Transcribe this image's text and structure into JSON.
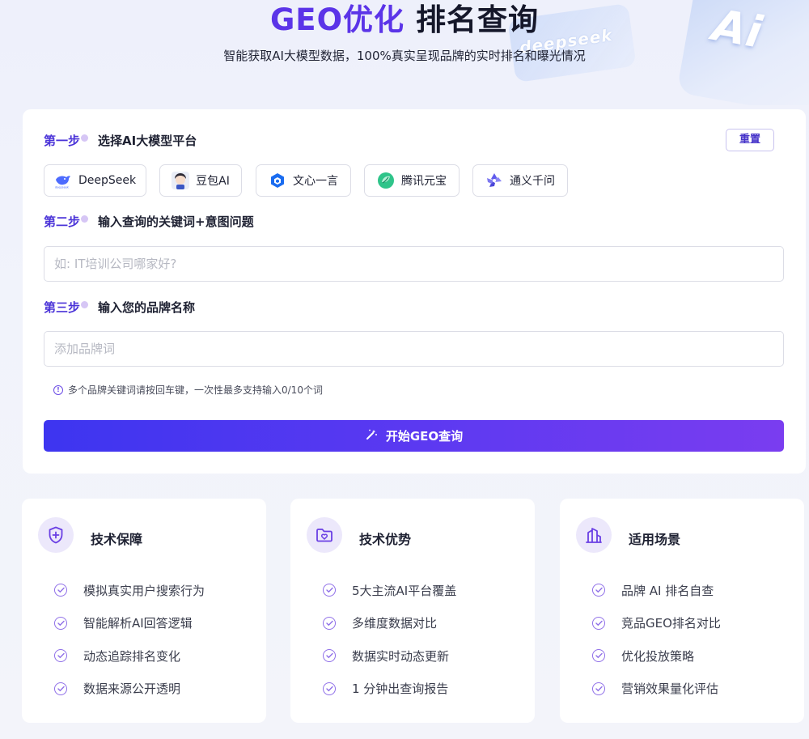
{
  "hero": {
    "title_accent": "GEO优化",
    "title_main": "排名查询",
    "subtitle": "智能获取AI大模型数据，100%真实呈现品牌的实时排名和曝光情况",
    "deco_badge": "deepseek",
    "deco_ai": "Ai"
  },
  "form": {
    "step1": {
      "num": "第一步",
      "label": "选择AI大模型平台"
    },
    "reset_label": "重置",
    "platforms": [
      {
        "label": "DeepSeek",
        "icon": "deepseek-whale-icon"
      },
      {
        "label": "豆包AI",
        "icon": "doubao-avatar-icon"
      },
      {
        "label": "文心一言",
        "icon": "wenxin-cube-icon"
      },
      {
        "label": "腾讯元宝",
        "icon": "yuanbao-leaf-icon"
      },
      {
        "label": "通义千问",
        "icon": "tongyi-star-icon"
      }
    ],
    "step2": {
      "num": "第二步",
      "label": "输入查询的关键词+意图问题"
    },
    "keyword_placeholder": "如: IT培训公司哪家好?",
    "step3": {
      "num": "第三步",
      "label": "输入您的品牌名称"
    },
    "brand_placeholder": "添加品牌词",
    "hint": "多个品牌关键词请按回车键，一次性最多支持输入0/10个词",
    "submit_label": "开始GEO查询"
  },
  "features": [
    {
      "title": "技术保障",
      "icon": "shield-plus-icon",
      "items": [
        "模拟真实用户搜索行为",
        "智能解析AI回答逻辑",
        "动态追踪排名变化",
        "数据来源公开透明"
      ]
    },
    {
      "title": "技术优势",
      "icon": "folder-heart-icon",
      "items": [
        "5大主流AI平台覆盖",
        "多维度数据对比",
        "数据实时动态更新",
        "1 分钟出查询报告"
      ]
    },
    {
      "title": "适用场景",
      "icon": "buildings-icon",
      "items": [
        "品牌 AI 排名自查",
        "竞品GEO排名对比",
        "优化投放策略",
        "营销效果量化评估"
      ]
    }
  ],
  "colors": {
    "accent": "#5b34e8",
    "button_start": "#3d35f0",
    "button_end": "#7a3df0"
  }
}
